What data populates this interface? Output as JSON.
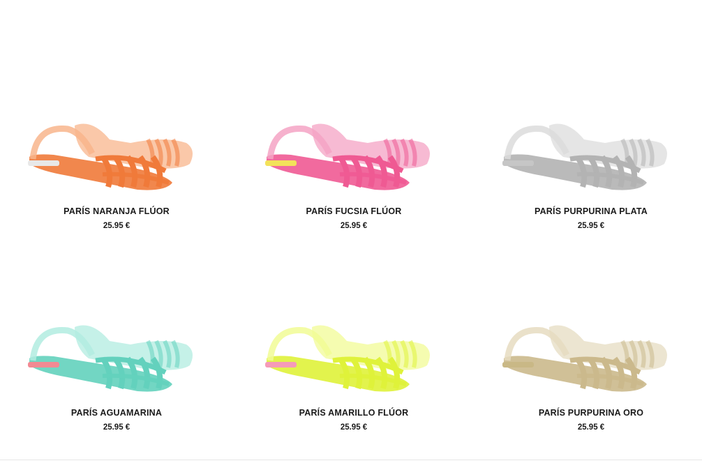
{
  "products": [
    {
      "name": "PARÍS NARANJA FLÚOR",
      "price": "25.95 €",
      "color": "#f07a3a",
      "light": "#f8b58c",
      "sole": "#e8e8e8"
    },
    {
      "name": "PARÍS FUCSIA FLÚOR",
      "price": "25.95 €",
      "color": "#ef5a93",
      "light": "#f4a3c4",
      "sole": "#f3e25a"
    },
    {
      "name": "PARÍS PURPURINA PLATA",
      "price": "25.95 €",
      "color": "#b3b3b3",
      "light": "#dcdcdc",
      "sole": "#c6c6c6"
    },
    {
      "name": "PARÍS AGUAMARINA",
      "price": "25.95 €",
      "color": "#63d1bd",
      "light": "#b2ece0",
      "sole": "#f28a93"
    },
    {
      "name": "PARÍS AMARILLO FLÚOR",
      "price": "25.95 €",
      "color": "#dff23a",
      "light": "#f1fb95",
      "sole": "#f59bb8"
    },
    {
      "name": "PARÍS PURPURINA ORO",
      "price": "25.95 €",
      "color": "#cbb98c",
      "light": "#e6dcc1",
      "sole": "#c9b886"
    }
  ]
}
